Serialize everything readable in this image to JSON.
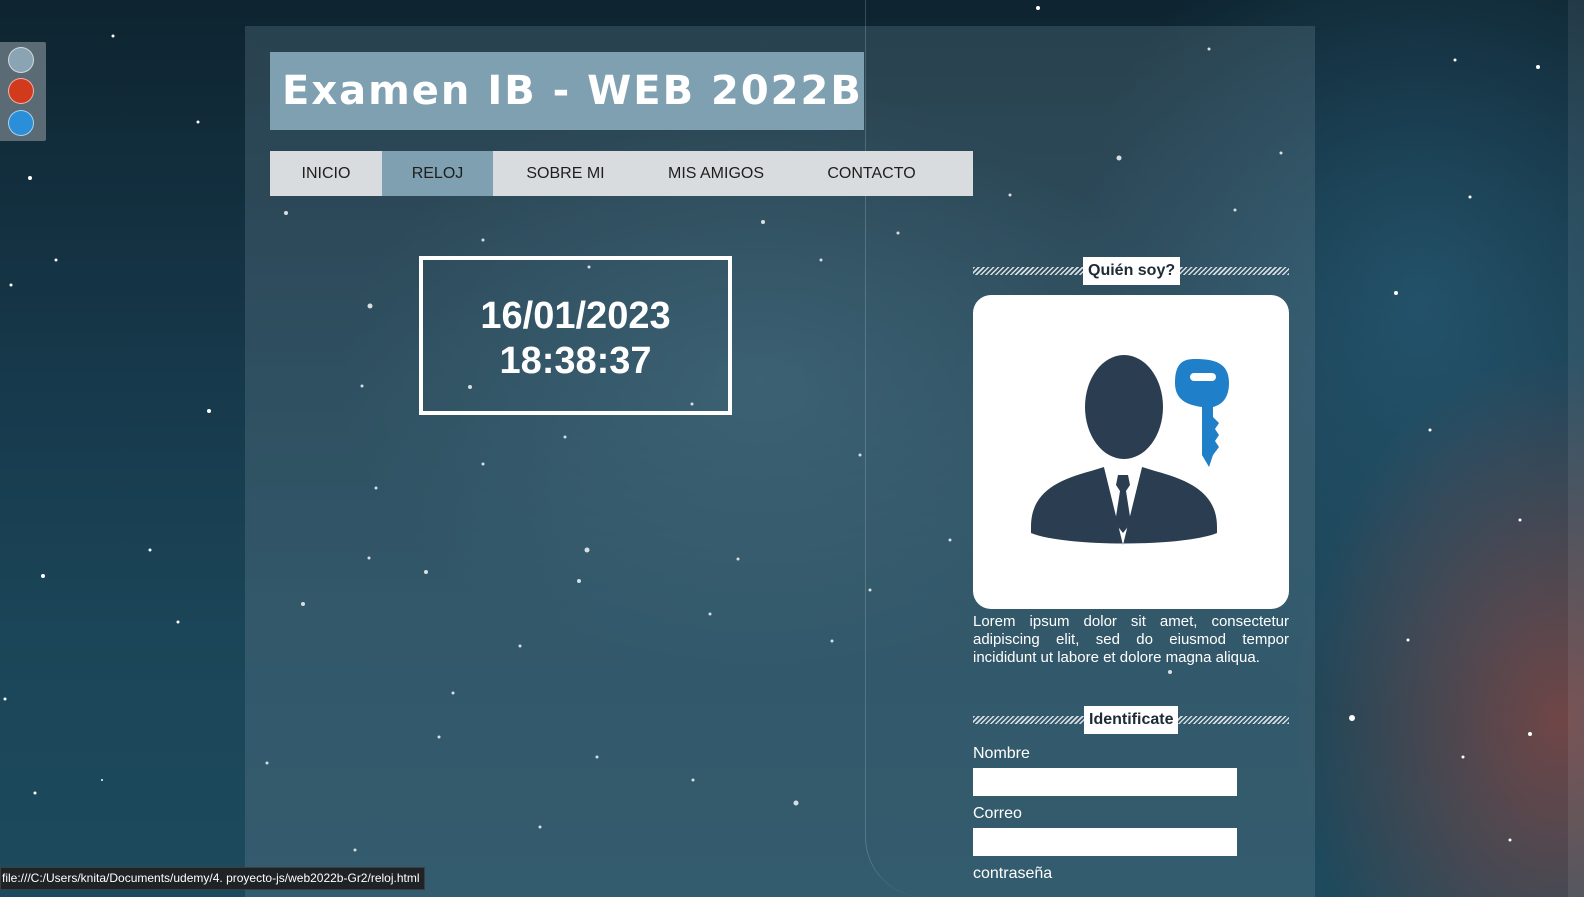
{
  "site": {
    "title": "Examen IB - WEB 2022B"
  },
  "theme_switcher": {
    "options": [
      {
        "name": "theme-gray",
        "color": "#8aa4b4"
      },
      {
        "name": "theme-red",
        "color": "#d23a1e"
      },
      {
        "name": "theme-blue",
        "color": "#2a8fd8"
      }
    ]
  },
  "nav": {
    "items": [
      {
        "label": "INICIO",
        "active": false
      },
      {
        "label": "RELOJ",
        "active": true
      },
      {
        "label": "SOBRE MI",
        "active": false
      },
      {
        "label": "MIS AMIGOS",
        "active": false
      },
      {
        "label": "CONTACTO",
        "active": false
      }
    ]
  },
  "clock": {
    "date": "16/01/2023",
    "time": "18:38:37"
  },
  "sidebar": {
    "about_heading": "Quién soy?",
    "avatar_icon": "businessman-with-key-icon",
    "bio": "Lorem ipsum dolor sit amet, consectetur adipiscing elit, sed do eiusmod tempor incididunt ut labore et dolore magna aliqua.",
    "login_heading": "Identificate",
    "fields": {
      "name_label": "Nombre",
      "email_label": "Correo",
      "password_label": "contraseña",
      "name_value": "",
      "email_value": ""
    }
  },
  "status_bar": {
    "url": "file:///C:/Users/knita/Documents/udemy/4. proyecto-js/web2022b-Gr2/reloj.html"
  },
  "colors": {
    "accent": "#7fa0b1",
    "nav_bg": "#d9dcde",
    "icon_dark": "#2b3d50",
    "icon_blue": "#1f7fc8"
  }
}
